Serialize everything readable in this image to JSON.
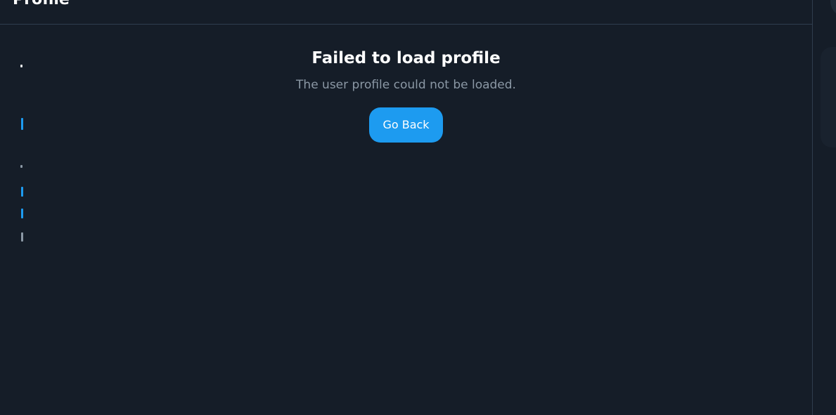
{
  "header": {
    "title": "Profile"
  },
  "error": {
    "title": "Failed to load profile",
    "message": "The user profile could not be loaded.",
    "back_label": "Go Back"
  },
  "colors": {
    "background": "#151d28",
    "border": "#2f3d4e",
    "accent": "#1d9bf0",
    "muted_text": "#8b98a5"
  }
}
